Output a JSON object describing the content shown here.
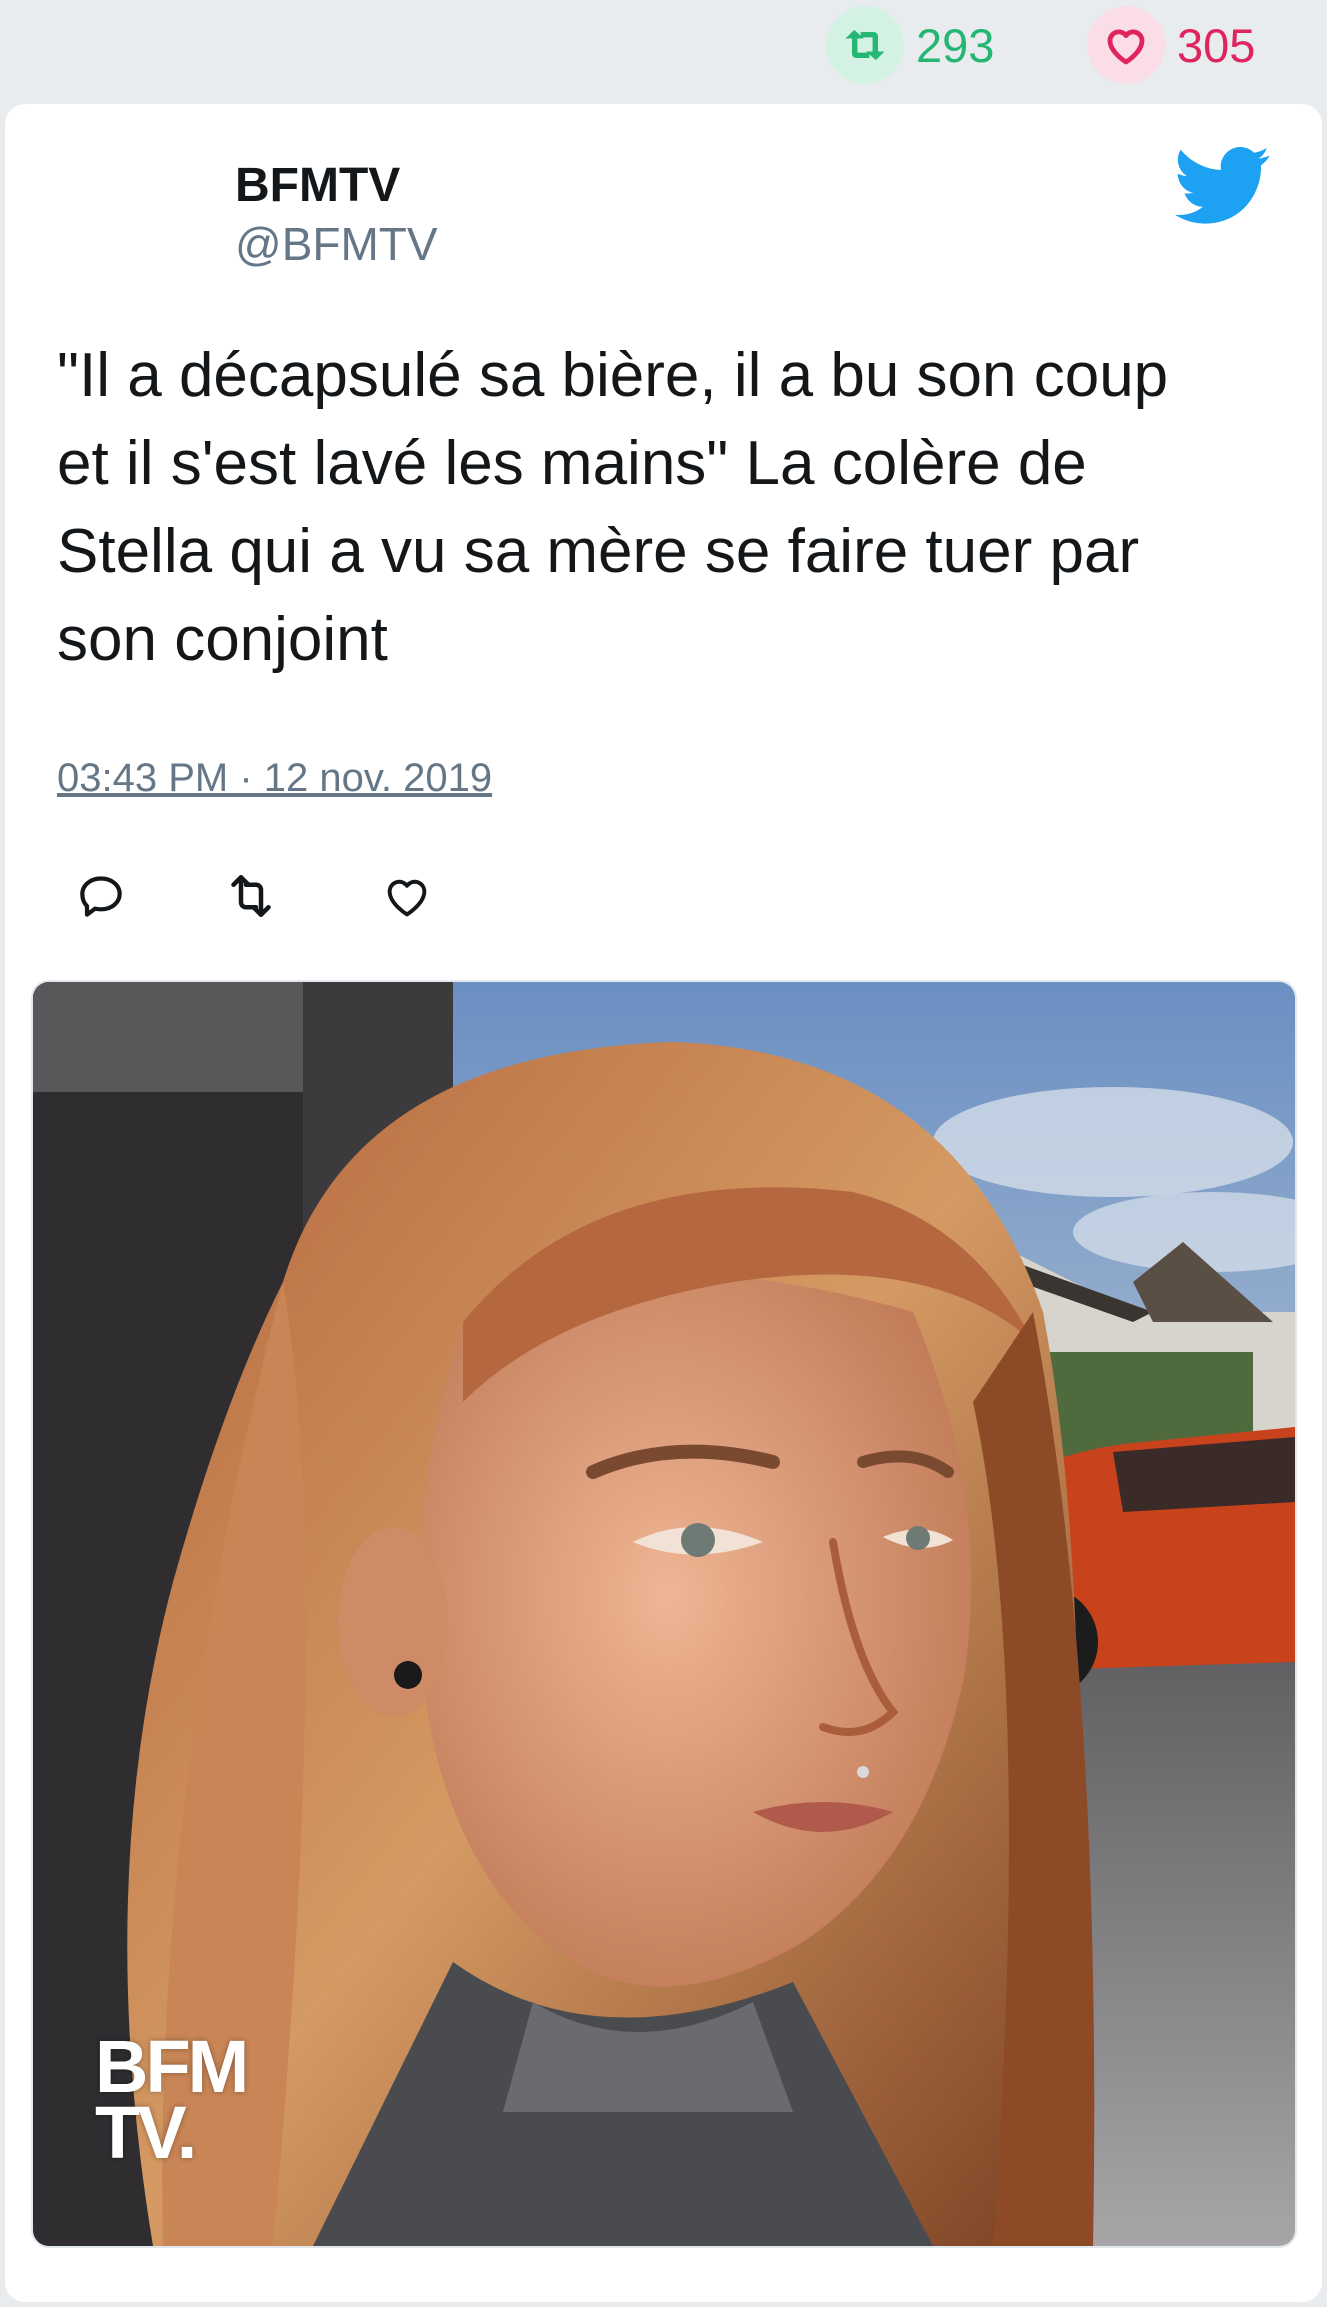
{
  "stats": {
    "retweets": "293",
    "likes": "305",
    "retweet_color": "#24b673",
    "like_color": "#e0245e"
  },
  "tweet": {
    "author_name": "BFMTV",
    "author_handle": "@BFMTV",
    "text": "\"Il a décapsulé sa bière, il a bu son coup\net il s'est lavé les mains\" La colère de\nStella qui a vu sa mère se faire tuer par\nson conjoint",
    "timestamp": "03:43 PM · 12 nov. 2019",
    "icons": {
      "brand": "twitter-bird-icon",
      "reply": "reply-icon",
      "retweet": "retweet-icon",
      "like": "heart-icon"
    }
  },
  "media": {
    "watermark_line1": "BFM",
    "watermark_line2": "TV."
  },
  "colors": {
    "twitter_blue": "#1da1f2",
    "text": "#14171a",
    "muted": "#657786",
    "background": "#e9ecef"
  }
}
